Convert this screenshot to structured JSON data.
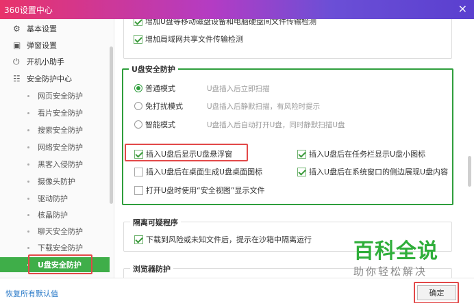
{
  "window": {
    "title": "360设置中心",
    "close_glyph": "×"
  },
  "sidebar": {
    "top_items": [
      {
        "label": "基本设置",
        "icon": "gear-icon"
      },
      {
        "label": "弹窗设置",
        "icon": "window-icon"
      },
      {
        "label": "开机小助手",
        "icon": "power-icon"
      },
      {
        "label": "安全防护中心",
        "icon": "shield-grid-icon"
      }
    ],
    "sub_items": [
      "网页安全防护",
      "看片安全防护",
      "搜索安全防护",
      "网络安全防护",
      "黑客入侵防护",
      "摄像头防护",
      "驱动防护",
      "核晶防护",
      "聊天安全防护",
      "下载安全防护"
    ],
    "active_item": "U盘安全防护"
  },
  "content": {
    "top_partial": "增加U盘等移动磁盘设备和电脑硬盘间文件传输检测",
    "top_lan": "增加局域网共享文件传输检测",
    "usb_group": {
      "title": "U盘安全防护",
      "modes": [
        {
          "label": "普通模式",
          "desc": "U盘插入后立即扫描",
          "selected": true
        },
        {
          "label": "免打扰模式",
          "desc": "U盘插入后静默扫描，有风险时提示",
          "selected": false
        },
        {
          "label": "智能模式",
          "desc": "U盘插入后自动打开U盘，同时静默扫描U盘",
          "selected": false
        }
      ],
      "options": [
        {
          "label": "插入U盘后显示U盘悬浮窗",
          "checked": true
        },
        {
          "label": "插入U盘后在任务栏显示U盘小图标",
          "checked": true
        },
        {
          "label": "插入U盘后在桌面生成U盘桌面图标",
          "checked": false
        },
        {
          "label": "插入U盘后在系统窗口的侧边展现U盘内容",
          "checked": true
        },
        {
          "label": "打开U盘时使用“安全视图”显示文件",
          "checked": false
        }
      ]
    },
    "quarantine_group": {
      "title": "隔离可疑程序",
      "option": {
        "label": "下载到风险或未知文件后，提示在沙箱中隔离运行",
        "checked": true
      }
    },
    "browser_group": {
      "title": "浏览器防护"
    }
  },
  "footer": {
    "restore_label": "恢复所有默认值",
    "ok_label": "确定"
  },
  "watermark": {
    "line1": "百科全说",
    "line2": "助你轻松解决"
  }
}
